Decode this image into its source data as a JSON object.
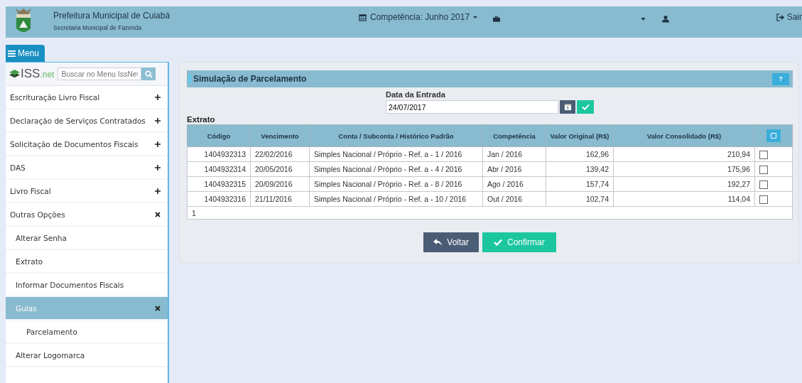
{
  "header": {
    "title": "Prefeitura Municipal de Cuiabá",
    "subtitle": "Secretaria Municipal de Fazenda",
    "period": "Competência: Junho 2017",
    "logout": "Sair"
  },
  "menu_button": "Menu",
  "sidebar": {
    "logo": {
      "main": "ISS",
      "suffix": ".net"
    },
    "search": {
      "placeholder": "Buscar no Menu IssNet"
    },
    "items": [
      {
        "label": "Escrituração Livro Fiscal",
        "expanded": false,
        "selected": false
      },
      {
        "label": "Declaração de Serviços Contratados",
        "expanded": false,
        "selected": false
      },
      {
        "label": "Solicitação de Documentos Fiscais",
        "expanded": false,
        "selected": false
      },
      {
        "label": "DAS",
        "expanded": false,
        "selected": false
      },
      {
        "label": "Livro Fiscal",
        "expanded": false,
        "selected": false
      },
      {
        "label": "Outras Opções",
        "expanded": true,
        "selected": false,
        "children": [
          {
            "label": "Alterar Senha",
            "selected": false
          },
          {
            "label": "Extrato",
            "selected": false
          },
          {
            "label": "Informar Documentos Fiscais",
            "selected": false
          },
          {
            "label": "Guias",
            "expanded": true,
            "selected": true,
            "children": [
              {
                "label": "Parcelamento",
                "selected": false
              }
            ]
          },
          {
            "label": "Alterar Logomarca",
            "selected": false
          }
        ]
      }
    ]
  },
  "panel": {
    "title": "Simulação de Parcelamento",
    "help": "?",
    "date_label": "Data da Entrada",
    "date_value": "24/07/2017",
    "section": "Extrato",
    "table": {
      "columns": [
        "Código",
        "Vencimento",
        "Conta / Subconta / Histórico Padrão",
        "Competência",
        "Valor Original (R$)",
        "Valor Consolidado (R$)"
      ],
      "rows": [
        {
          "cells": [
            "1404932313",
            "22/02/2016",
            "Simples Nacional / Próprio - Ref. a - 1 / 2016",
            "Jan / 2016",
            "162,96",
            "210,94"
          ],
          "checked": false
        },
        {
          "cells": [
            "1404932314",
            "20/05/2016",
            "Simples Nacional / Próprio - Ref. a - 4 / 2016",
            "Abr / 2016",
            "139,42",
            "175,96"
          ],
          "checked": false
        },
        {
          "cells": [
            "1404932315",
            "20/09/2016",
            "Simples Nacional / Próprio - Ref. a - 8 / 2016",
            "Ago / 2016",
            "157,74",
            "192,27"
          ],
          "checked": false
        },
        {
          "cells": [
            "1404932316",
            "21/11/2016",
            "Simples Nacional / Próprio - Ref. a - 10 / 2016",
            "Out / 2016",
            "102,74",
            "114,04"
          ],
          "checked": false
        }
      ],
      "page": "1"
    },
    "buttons": [
      {
        "label": "Voltar",
        "kind": "back"
      },
      {
        "label": "Confirmar",
        "kind": "confirm"
      }
    ]
  }
}
